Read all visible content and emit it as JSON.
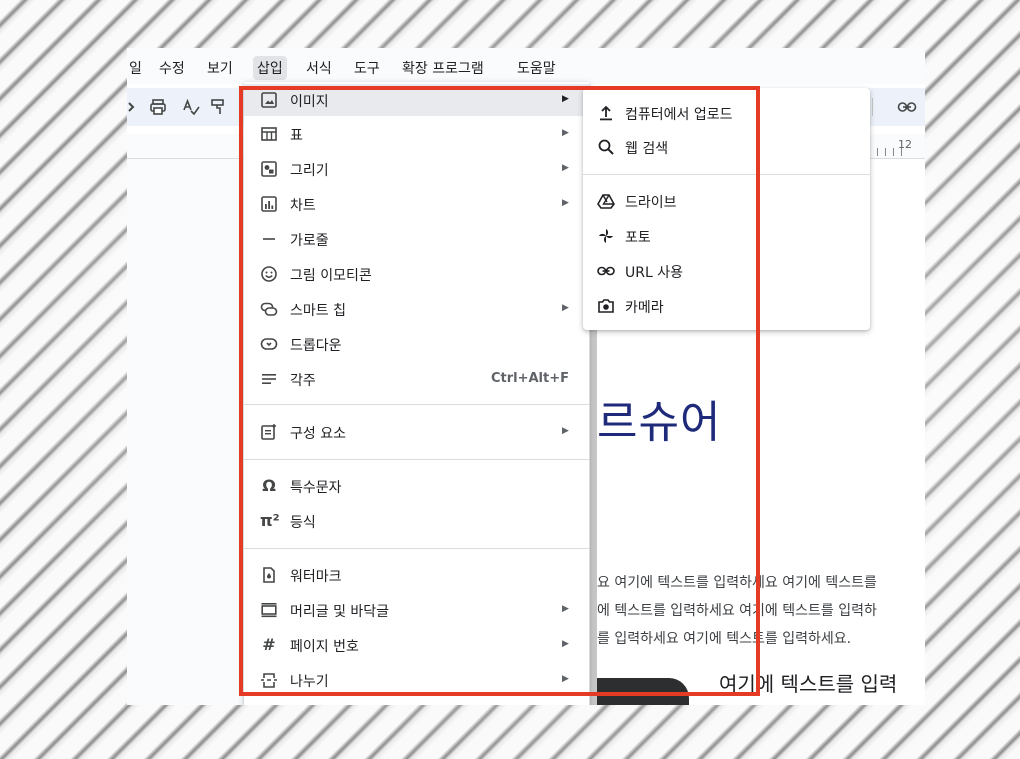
{
  "menubar": {
    "items": [
      "일",
      "수정",
      "보기",
      "삽입",
      "서식",
      "도구",
      "확장 프로그램",
      "도움말"
    ]
  },
  "ruler": {
    "tick_label": "12"
  },
  "insert_menu": {
    "image": "이미지",
    "table": "표",
    "drawing": "그리기",
    "chart": "차트",
    "horizontal_line": "가로줄",
    "emoji": "그림 이모티콘",
    "smart_chips": "스마트 칩",
    "dropdown": "드롭다운",
    "footnote": "각주",
    "footnote_shortcut": "Ctrl+Alt+F",
    "building_blocks": "구성 요소",
    "special_chars": "특수문자",
    "equation": "등식",
    "watermark": "워터마크",
    "headers_footers": "머리글 및 바닥글",
    "page_numbers": "페이지 번호",
    "break": "나누기"
  },
  "image_submenu": {
    "upload": "컴퓨터에서 업로드",
    "web_search": "웹 검색",
    "drive": "드라이브",
    "photos": "포토",
    "by_url": "URL 사용",
    "camera": "카메라"
  },
  "document": {
    "heading": "르슈어",
    "body_line_1": "요 여기에 텍스트를 입력하세요 여기에 텍스트를",
    "body_line_2": "에 텍스트를 입력하세요 여기에 텍스트를 입력하",
    "body_line_3": "를 입력하세요 여기에 텍스트를 입력하세요.",
    "sub_heading": "여기에 텍스트를 입력"
  },
  "colors": {
    "highlight_border": "#e53a24",
    "menu_hover": "#e8eaed",
    "heading_color": "#1f2a7a"
  }
}
